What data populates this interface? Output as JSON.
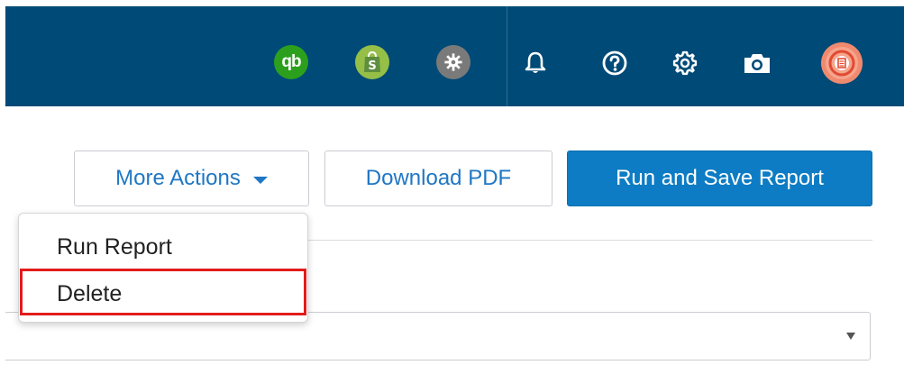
{
  "topbar": {
    "app_icons": [
      {
        "name": "quickbooks-icon",
        "glyph": "qb",
        "color": "#2ca01c"
      },
      {
        "name": "shopify-icon",
        "glyph": "S",
        "color": "#95bf47"
      },
      {
        "name": "app-settings-icon",
        "glyph": "",
        "color": "#7a7a7a"
      }
    ],
    "utility_icons": [
      "bell-icon",
      "help-icon",
      "gear-icon",
      "camera-icon"
    ],
    "avatar_icon": "user-avatar-icon",
    "background_color": "#004a77"
  },
  "toolbar": {
    "more_actions_label": "More Actions",
    "download_pdf_label": "Download PDF",
    "run_save_label": "Run and Save Report"
  },
  "dropdown_menu": {
    "items": [
      {
        "label": "Run Report"
      },
      {
        "label": "Delete"
      }
    ],
    "highlighted_item": "Delete",
    "highlight_color": "#e21b1b"
  },
  "select_field": {
    "value": ""
  },
  "colors": {
    "primary": "#0d7cc4",
    "link": "#1f77c4"
  }
}
